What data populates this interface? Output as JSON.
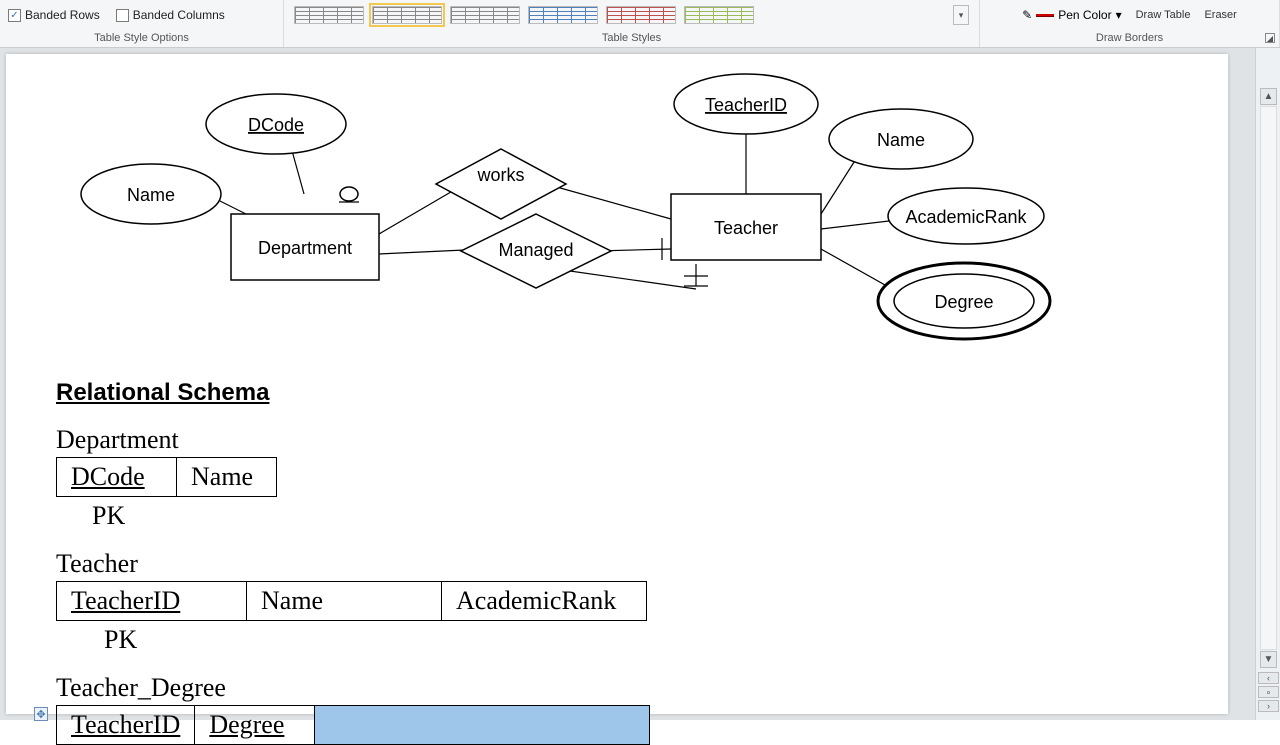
{
  "ribbon": {
    "options_group_label": "Table Style Options",
    "styles_group_label": "Table Styles",
    "borders_group_label": "Draw Borders",
    "banded_rows": "Banded Rows",
    "banded_columns": "Banded Columns",
    "pen_color": "Pen Color",
    "draw_table": "Draw Table",
    "eraser": "Eraser"
  },
  "er": {
    "dcode": "DCode",
    "name_dept": "Name",
    "department": "Department",
    "works": "works",
    "managed": "Managed",
    "teacher": "Teacher",
    "teacher_id": "TeacherID",
    "name_teacher": "Name",
    "academic_rank": "AcademicRank",
    "degree": "Degree"
  },
  "schema": {
    "heading": "Relational Schema",
    "dept_name": "Department",
    "dept_cols": {
      "c1": "DCode",
      "c2": "Name"
    },
    "pk": "PK",
    "teacher_name": "Teacher",
    "teacher_cols": {
      "c1": "TeacherID",
      "c2": "Name",
      "c3": "AcademicRank"
    },
    "tdeg_name": "Teacher_Degree",
    "tdeg_cols": {
      "c1": "TeacherID",
      "c2": "Degree",
      "c3": ""
    }
  },
  "chart_data": {
    "type": "table",
    "title": "Relational Schema derived from ER diagram",
    "entities": [
      {
        "name": "Department",
        "attributes": [
          "DCode",
          "Name"
        ],
        "primary_key": "DCode"
      },
      {
        "name": "Teacher",
        "attributes": [
          "TeacherID",
          "Name",
          "AcademicRank",
          "Degree"
        ],
        "primary_key": "TeacherID",
        "multivalued": [
          "Degree"
        ]
      }
    ],
    "relationships": [
      {
        "name": "works",
        "between": [
          "Department",
          "Teacher"
        ]
      },
      {
        "name": "Managed",
        "between": [
          "Department",
          "Teacher"
        ]
      }
    ],
    "relational_tables": [
      {
        "name": "Department",
        "columns": [
          "DCode",
          "Name"
        ],
        "pk": [
          "DCode"
        ]
      },
      {
        "name": "Teacher",
        "columns": [
          "TeacherID",
          "Name",
          "AcademicRank"
        ],
        "pk": [
          "TeacherID"
        ]
      },
      {
        "name": "Teacher_Degree",
        "columns": [
          "TeacherID",
          "Degree"
        ],
        "pk": [
          "TeacherID",
          "Degree"
        ]
      }
    ]
  }
}
